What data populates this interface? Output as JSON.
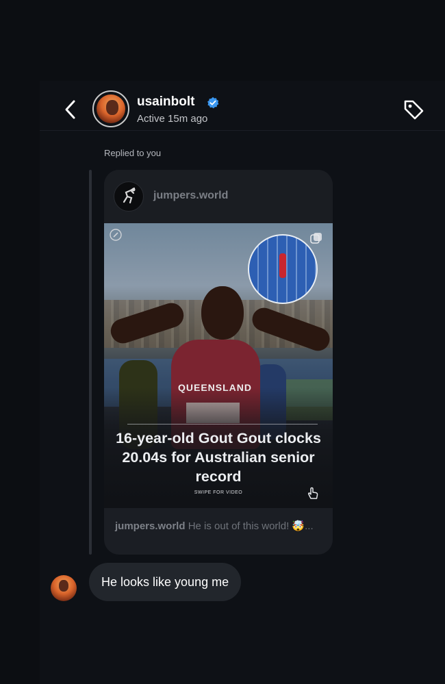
{
  "header": {
    "username": "usainbolt",
    "status": "Active 15m ago",
    "icons": {
      "back": "chevron-left-icon",
      "verified": "verified-badge-icon",
      "tag": "tag-icon"
    },
    "accent": "#3a97f0"
  },
  "reply_label": "Replied to you",
  "shared_post": {
    "source_account": "jumpers.world",
    "jersey_text": "QUEENSLAND",
    "headline": "16-year-old Gout Gout clocks 20.04s for Australian senior record",
    "swipe_hint": "SWIPE FOR VIDEO",
    "caption_account": "jumpers.world",
    "caption_text": "He is out of this world! 🤯..."
  },
  "message": {
    "text": "He looks like young me"
  }
}
